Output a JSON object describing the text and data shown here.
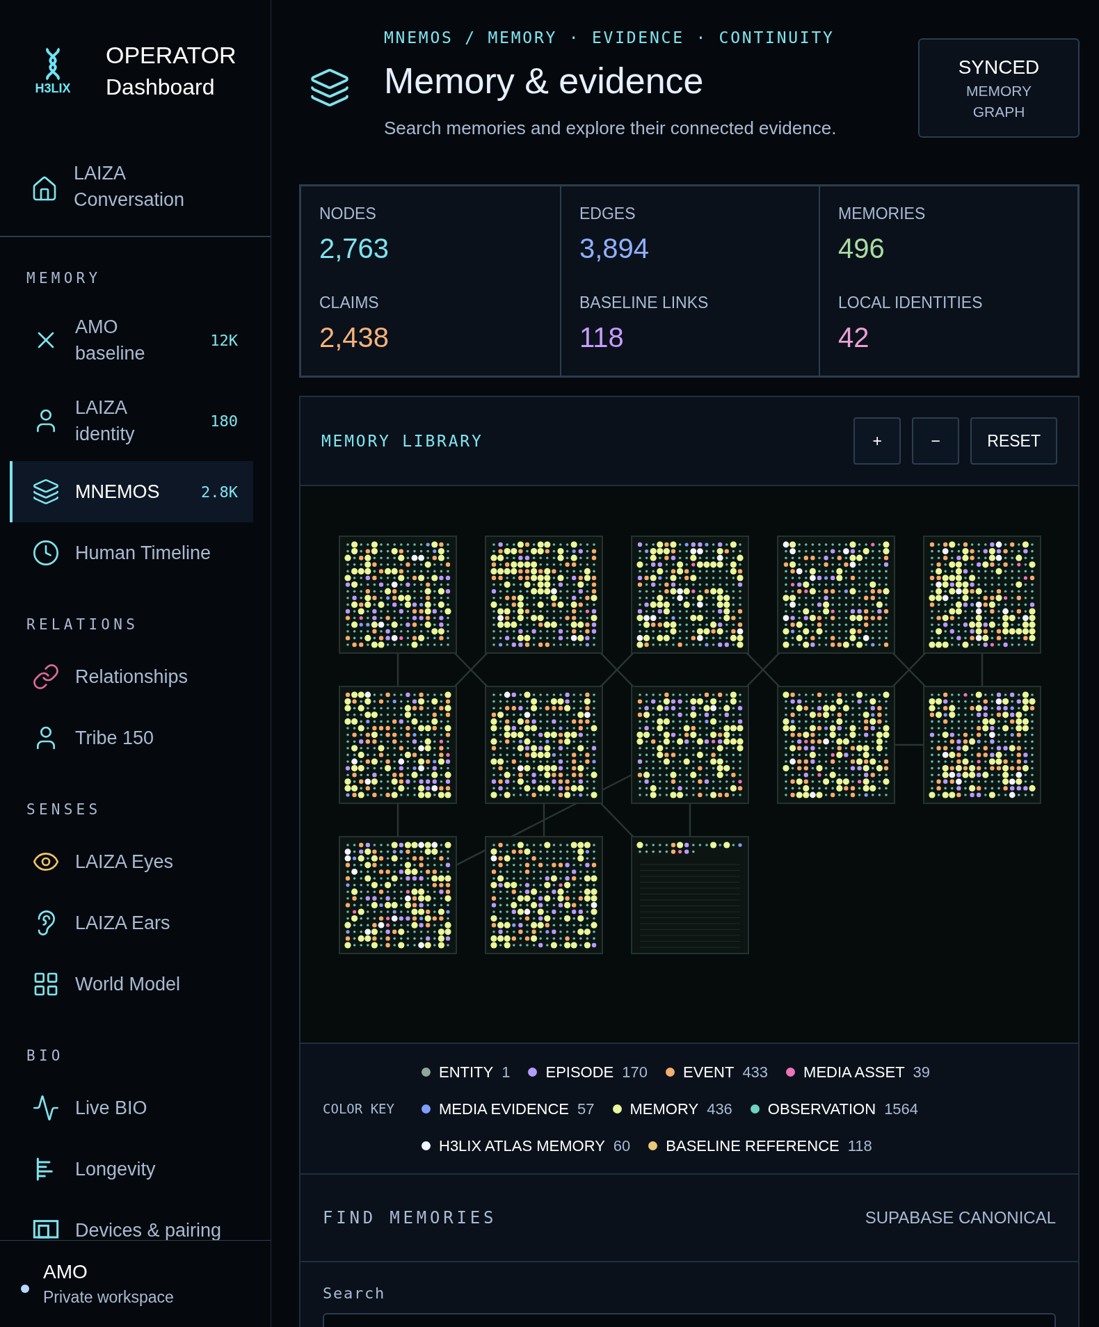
{
  "sidebar": {
    "logo_text": "H3LIX",
    "title": "OPERATOR",
    "subtitle": "Dashboard",
    "home": {
      "label": "LAIZA Conversation"
    },
    "sections": [
      {
        "title": "MEMORY",
        "items": [
          {
            "label": "AMO baseline",
            "badge": "12K",
            "selected": false
          },
          {
            "label": "LAIZA identity",
            "badge": "180",
            "selected": false
          },
          {
            "label": "MNEMOS",
            "badge": "2.8K",
            "selected": true
          },
          {
            "label": "Human Timeline",
            "selected": false
          }
        ]
      },
      {
        "title": "RELATIONS",
        "items": [
          {
            "label": "Relationships",
            "selected": false
          },
          {
            "label": "Tribe 150",
            "selected": false
          }
        ]
      },
      {
        "title": "SENSES",
        "items": [
          {
            "label": "LAIZA Eyes",
            "selected": false
          },
          {
            "label": "LAIZA Ears",
            "selected": false
          },
          {
            "label": "World Model",
            "selected": false
          }
        ]
      },
      {
        "title": "BIO",
        "items": [
          {
            "label": "Live BIO",
            "selected": false
          },
          {
            "label": "Longevity",
            "selected": false
          },
          {
            "label": "Devices & pairing",
            "selected": false
          }
        ]
      }
    ],
    "footer": {
      "name": "AMO",
      "workspace": "Private workspace"
    }
  },
  "header": {
    "breadcrumb": "MNEMOS / MEMORY · EVIDENCE · CONTINUITY",
    "title": "Memory & evidence",
    "subtitle": "Search memories and explore their connected evidence.",
    "status": {
      "title": "SYNCED",
      "caption": "MEMORY GRAPH"
    }
  },
  "stats": [
    {
      "label": "NODES",
      "value": "2,763",
      "color": "#7fe3ee"
    },
    {
      "label": "EDGES",
      "value": "3,894",
      "color": "#8fb0ff"
    },
    {
      "label": "MEMORIES",
      "value": "496",
      "color": "#a8dca0"
    },
    {
      "label": "CLAIMS",
      "value": "2,438",
      "color": "#f7b27a"
    },
    {
      "label": "BASELINE LINKS",
      "value": "118",
      "color": "#c79cff"
    },
    {
      "label": "LOCAL IDENTITIES",
      "value": "42",
      "color": "#eaa0d4"
    }
  ],
  "library": {
    "title": "MEMORY LIBRARY",
    "buttons": [
      "+",
      "−",
      "RESET"
    ],
    "legend": {
      "label": "COLOR KEY",
      "items": [
        {
          "name": "ENTITY",
          "count": "1",
          "color": "#8fa89a"
        },
        {
          "name": "EPISODE",
          "count": "170",
          "color": "#b79cff"
        },
        {
          "name": "EVENT",
          "count": "433",
          "color": "#f5ad6e"
        },
        {
          "name": "MEDIA ASSET",
          "count": "39",
          "color": "#ee74b8"
        },
        {
          "name": "MEDIA EVIDENCE",
          "count": "57",
          "color": "#7f9fff"
        },
        {
          "name": "MEMORY",
          "count": "436",
          "color": "#eaf79a"
        },
        {
          "name": "OBSERVATION",
          "count": "1564",
          "color": "#6ed3c0"
        },
        {
          "name": "H3LIX ATLAS MEMORY",
          "count": "60",
          "color": "#f3f4ff"
        },
        {
          "name": "BASELINE REFERENCE",
          "count": "118",
          "color": "#e8c878"
        }
      ]
    }
  },
  "find": {
    "title": "FIND MEMORIES",
    "source": "SUPABASE CANONICAL",
    "search_label": "Search"
  }
}
